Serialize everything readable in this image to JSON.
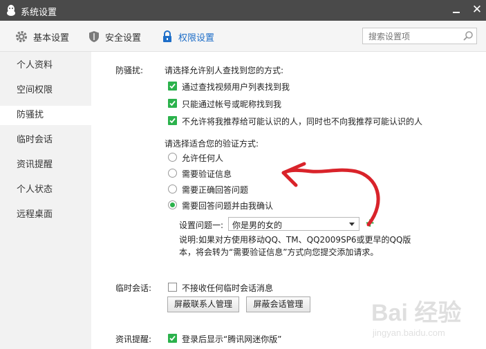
{
  "window": {
    "title": "系统设置"
  },
  "tabs": [
    {
      "label": "基本设置",
      "icon": "gear-icon"
    },
    {
      "label": "安全设置",
      "icon": "shield-icon"
    },
    {
      "label": "权限设置",
      "icon": "lock-icon",
      "active": true
    }
  ],
  "search": {
    "placeholder": "搜索设置项"
  },
  "sidebar": {
    "items": [
      {
        "label": "个人资料"
      },
      {
        "label": "空间权限"
      },
      {
        "label": "防骚扰",
        "active": true
      },
      {
        "label": "临时会话"
      },
      {
        "label": "资讯提醒"
      },
      {
        "label": "个人状态"
      },
      {
        "label": "远程桌面"
      }
    ]
  },
  "harass": {
    "section_label": "防骚扰:",
    "find_prompt": "请选择允许别人查找到您的方式:",
    "find_options": [
      {
        "label": "通过查找视频用户列表找到我",
        "checked": true
      },
      {
        "label": "只能通过帐号或昵称找到我",
        "checked": true
      },
      {
        "label": "不允许将我推荐给可能认识的人，同时也不向我推荐可能认识的人",
        "checked": true
      }
    ],
    "verify_prompt": "请选择适合您的验证方式:",
    "verify_options": [
      {
        "label": "允许任何人",
        "selected": false
      },
      {
        "label": "需要验证信息",
        "selected": false
      },
      {
        "label": "需要正确回答问题",
        "selected": false
      },
      {
        "label": "需要回答问题并由我确认",
        "selected": true
      }
    ],
    "question_label": "设置问题一:",
    "question_value": "你是男的女的",
    "note": "说明:如果对方使用移动QQ、TM、QQ2009SP6或更早的QQ版本，将会转为“需要验证信息”方式向您提交添加请求。"
  },
  "temp_chat": {
    "section_label": "临时会话:",
    "option": {
      "label": "不接收任何临时会话消息",
      "checked": false
    },
    "block_contacts_button": "屏蔽联系人管理",
    "block_sessions_button": "屏蔽会话管理"
  },
  "news": {
    "section_label": "资讯提醒:",
    "option": {
      "label": "登录后显示“腾讯网迷你版”",
      "checked": true
    }
  },
  "watermark": {
    "text": "Bai 经验",
    "subtext": "jingyan.baidu.com"
  },
  "colors": {
    "accent": "#2bb24c",
    "active_tab": "#1e6ec8",
    "annotation": "#d9232a",
    "titlebar": "#4a4a4a"
  }
}
